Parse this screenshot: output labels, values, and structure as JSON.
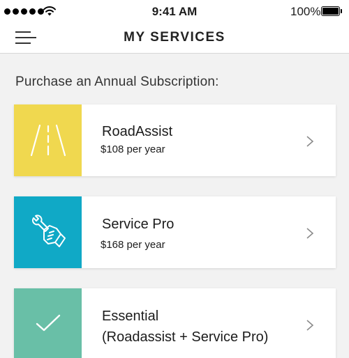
{
  "status_bar": {
    "time": "9:41 AM",
    "battery_percent": "100%",
    "signal_bars": 5,
    "wifi_icon": "wifi-icon",
    "battery_icon": "battery-full-icon"
  },
  "nav": {
    "title": "MY SERVICES",
    "menu_icon": "hamburger-menu-icon"
  },
  "section_heading": "Purchase an Annual Subscription:",
  "services": [
    {
      "name": "RoadAssist",
      "price": "$108 per year",
      "icon": "road-icon",
      "tile_color": "#f0d84f"
    },
    {
      "name": "Service Pro",
      "price": "$168 per year",
      "icon": "wrench-hand-icon",
      "tile_color": "#10a9c6"
    },
    {
      "name_line1": "Essential",
      "name_line2": "(Roadassist + Service Pro)",
      "icon": "checkmark-icon",
      "tile_color": "#69bfa7"
    }
  ],
  "colors": {
    "background": "#f2f2f2",
    "card": "#ffffff",
    "text": "#1c1c1c",
    "chevron": "#8a8a8a"
  }
}
